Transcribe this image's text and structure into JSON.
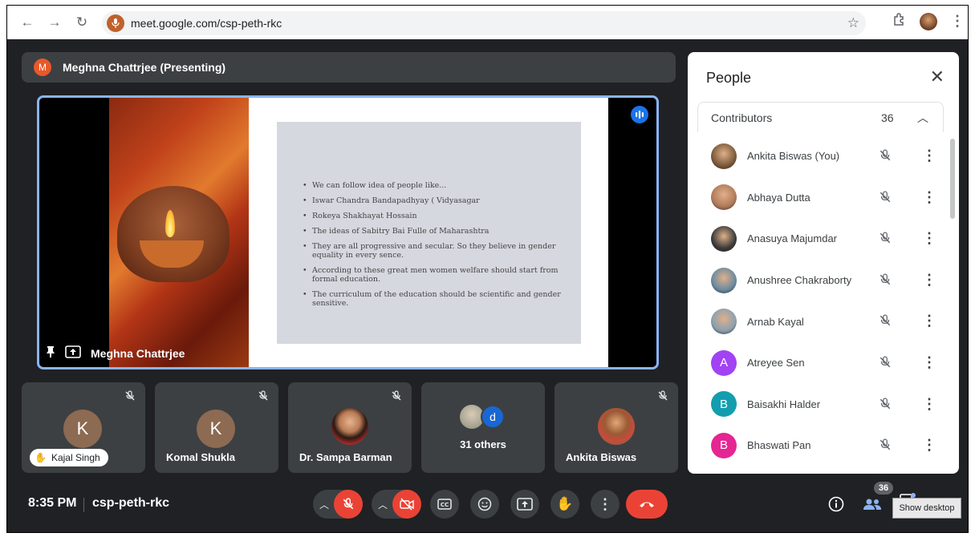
{
  "browser": {
    "url": "meet.google.com/csp-peth-rkc"
  },
  "presenter": {
    "title": "Meghna Chattrjee (Presenting)",
    "initial": "M"
  },
  "stage": {
    "presenter_name": "Meghna Chattrjee",
    "slide_bullets": [
      "We can follow idea of people like...",
      "Iswar Chandra Bandapadhyay ( Vidyasagar",
      "Rokeya  Shakhayat Hossain",
      "The ideas of Sabitry Bai Fulle of Maharashtra",
      "They are all progressive and secular. So they believe in gender equality in every sence.",
      "According to these great men women welfare should start from formal education.",
      "The curriculum of the education should be scientific and gender sensitive."
    ]
  },
  "tiles": [
    {
      "initial": "K",
      "name": "Kajal Singh"
    },
    {
      "initial": "K",
      "name": "Komal Shukla"
    },
    {
      "name": "Dr. Sampa Barman"
    },
    {
      "initial": "d",
      "name": "31 others"
    },
    {
      "name": "Ankita Biswas"
    }
  ],
  "panel": {
    "title": "People",
    "section_label": "Contributors",
    "section_count": "36",
    "people": [
      {
        "name": "Ankita Biswas (You)",
        "initial": "",
        "color": "#7a5a3a"
      },
      {
        "name": "Abhaya Dutta",
        "initial": "",
        "color": "#b07a5a"
      },
      {
        "name": "Anasuya Majumdar",
        "initial": "",
        "color": "#3a3a3a"
      },
      {
        "name": "Anushree Chakraborty",
        "initial": "",
        "color": "#6a8aa0"
      },
      {
        "name": "Arnab Kayal",
        "initial": "",
        "color": "#8aa0b0"
      },
      {
        "name": "Atreyee Sen",
        "initial": "A",
        "color": "#a142f4"
      },
      {
        "name": "Baisakhi Halder",
        "initial": "B",
        "color": "#129eaf"
      },
      {
        "name": "Bhaswati Pan",
        "initial": "B",
        "color": "#e52592"
      }
    ]
  },
  "bottom": {
    "time": "8:35 PM",
    "meeting_code": "csp-peth-rkc",
    "people_count": "36",
    "tooltip": "Show desktop"
  },
  "colors": {
    "background": "#202124",
    "tile": "#3c4043",
    "accent_blue": "#8ab4f8",
    "danger_red": "#ea4335"
  }
}
